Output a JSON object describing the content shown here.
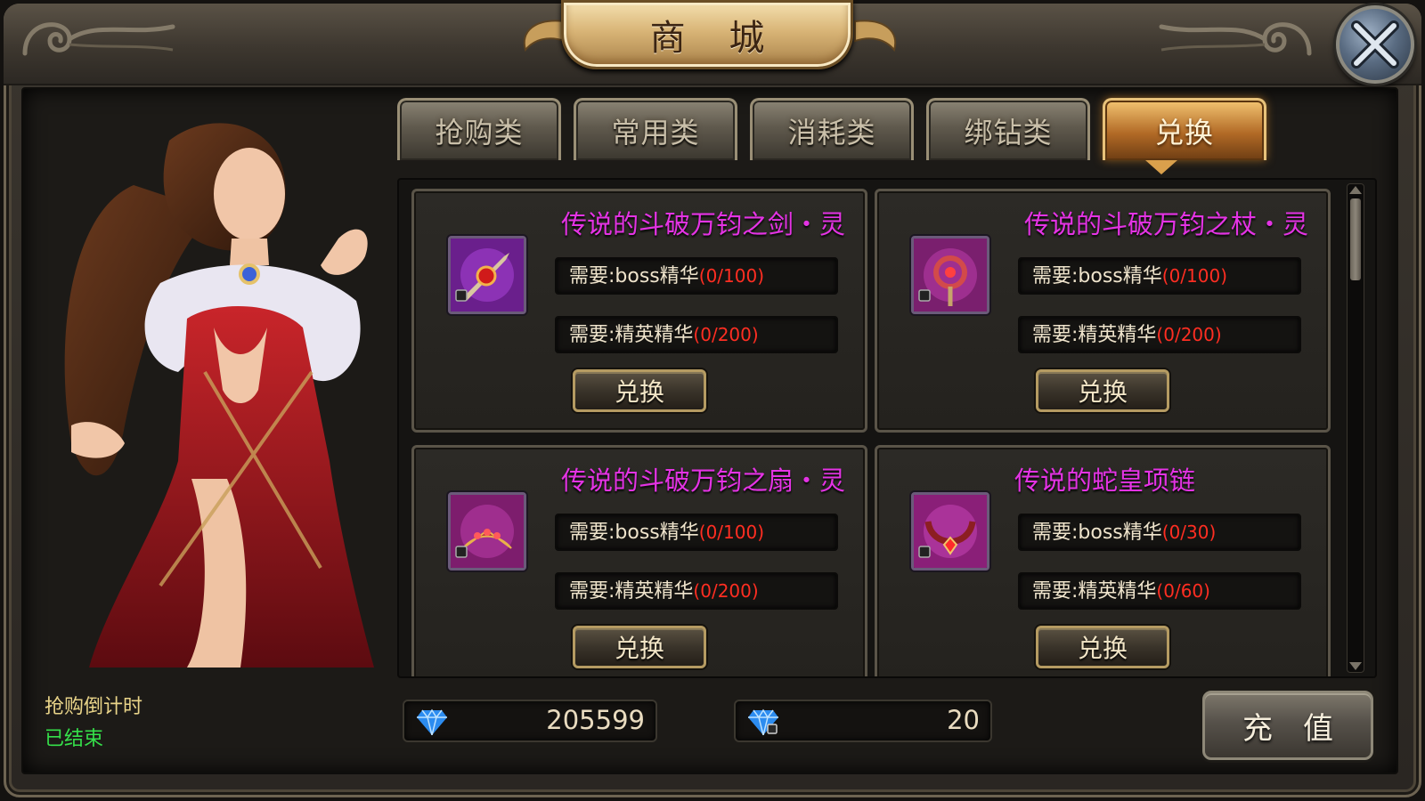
{
  "window": {
    "title": "商 城",
    "close_icon": "close-icon"
  },
  "tabs": [
    {
      "label": "抢购类",
      "active": false
    },
    {
      "label": "常用类",
      "active": false
    },
    {
      "label": "消耗类",
      "active": false
    },
    {
      "label": "绑钻类",
      "active": false
    },
    {
      "label": "兑换",
      "active": true
    }
  ],
  "left_panel": {
    "countdown_label": "抢购倒计时",
    "countdown_status": "已结束"
  },
  "items": [
    {
      "name": "传说的斗破万钧之剑・灵",
      "icon": "sword-icon",
      "requirements": [
        {
          "label": "需要:boss精华",
          "value": "(0/100)"
        },
        {
          "label": "需要:精英精华",
          "value": "(0/200)"
        }
      ],
      "button": "兑换"
    },
    {
      "name": "传说的斗破万钧之杖・灵",
      "icon": "staff-icon",
      "requirements": [
        {
          "label": "需要:boss精华",
          "value": "(0/100)"
        },
        {
          "label": "需要:精英精华",
          "value": "(0/200)"
        }
      ],
      "button": "兑换"
    },
    {
      "name": "传说的斗破万钧之扇・灵",
      "icon": "fan-icon",
      "requirements": [
        {
          "label": "需要:boss精华",
          "value": "(0/100)"
        },
        {
          "label": "需要:精英精华",
          "value": "(0/200)"
        }
      ],
      "button": "兑换"
    },
    {
      "name": "传说的蛇皇项链",
      "icon": "necklace-icon",
      "requirements": [
        {
          "label": "需要:boss精华",
          "value": "(0/30)"
        },
        {
          "label": "需要:精英精华",
          "value": "(0/60)"
        }
      ],
      "button": "兑换"
    }
  ],
  "currency": {
    "diamonds": "205599",
    "bound_diamonds": "20"
  },
  "recharge_button": "充值",
  "colors": {
    "item_name": "#e433e4",
    "requirement_value": "#ff2e22",
    "countdown_label": "#e9d489",
    "countdown_status": "#35e04a",
    "active_tab": "#d9a04c"
  }
}
